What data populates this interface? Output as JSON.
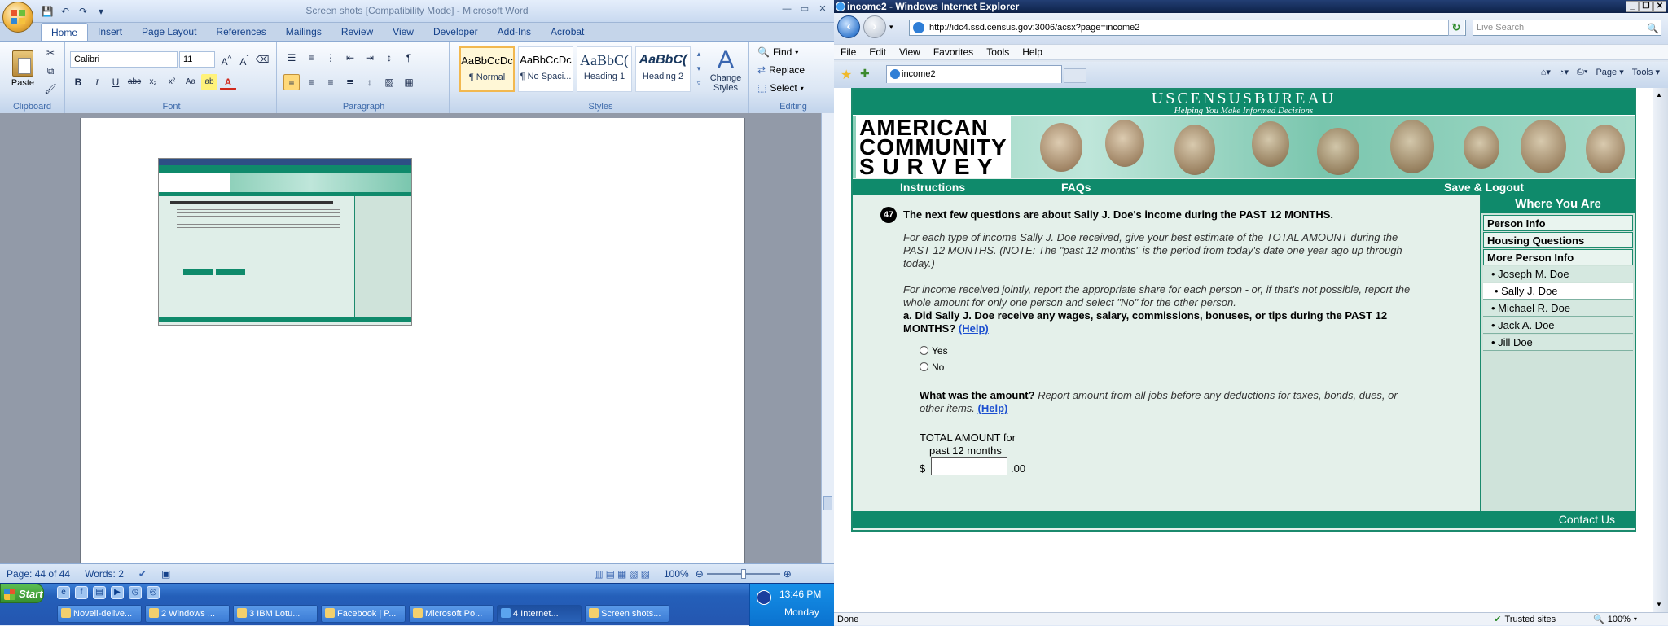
{
  "word": {
    "title": "Screen shots [Compatibility Mode] - Microsoft Word",
    "tabs": [
      "Home",
      "Insert",
      "Page Layout",
      "References",
      "Mailings",
      "Review",
      "View",
      "Developer",
      "Add-Ins",
      "Acrobat"
    ],
    "clipboard": {
      "paste": "Paste",
      "label": "Clipboard"
    },
    "font": {
      "name": "Calibri",
      "size": "11",
      "label": "Font"
    },
    "paragraph_label": "Paragraph",
    "styles": {
      "items": [
        {
          "preview": "AaBbCcDc",
          "name": "¶ Normal"
        },
        {
          "preview": "AaBbCcDc",
          "name": "¶ No Spaci..."
        },
        {
          "preview": "AaBbC(",
          "name": "Heading 1"
        },
        {
          "preview": "AaBbC(",
          "name": "Heading 2"
        }
      ],
      "change_styles": "Change Styles",
      "label": "Styles"
    },
    "editing": {
      "find": "Find",
      "replace": "Replace",
      "select": "Select",
      "label": "Editing"
    },
    "status": {
      "page": "Page: 44 of 44",
      "words": "Words: 2",
      "zoom": "100%"
    }
  },
  "taskbar": {
    "start": "Start",
    "buttons": [
      "Novell-delive...",
      "2 Windows ...",
      "3 IBM Lotu...",
      "Facebook | P...",
      "Microsoft Po...",
      "4 Internet...",
      "Screen shots..."
    ],
    "time": "13:46 PM",
    "day": "Monday"
  },
  "ie": {
    "title": "income2 - Windows Internet Explorer",
    "url": "http://idc4.ssd.census.gov:3006/acsx?page=income2",
    "search_placeholder": "Live Search",
    "menu": [
      "File",
      "Edit",
      "View",
      "Favorites",
      "Tools",
      "Help"
    ],
    "tab": "income2",
    "commands": [
      "Page",
      "Tools"
    ],
    "status_left": "Done",
    "status_zone": "Trusted sites",
    "status_zoom": "100%"
  },
  "census": {
    "header": "USCENSUSBUREAU",
    "tagline": "Helping You Make Informed Decisions",
    "logo": [
      "AMERICAN",
      "COMMUNITY",
      "S U R V E Y"
    ],
    "nav": {
      "instructions": "Instructions",
      "faqs": "FAQs",
      "save_logout": "Save & Logout"
    },
    "question_number": "47",
    "question_title": "The next few questions are about Sally J. Doe's income during the PAST 12 MONTHS.",
    "para1": "For each type of income Sally J. Doe received, give your best estimate of the TOTAL AMOUNT during the PAST 12 MONTHS. (NOTE: The \"past 12 months\" is the period from today's date one year ago up through today.)",
    "para2": "For income received jointly, report the appropriate share for each person - or, if that's not possible, report the whole amount for only one person and select \"No\" for the other person.",
    "part_a": "a. Did Sally J. Doe receive any wages, salary, commissions, bonuses, or tips during the PAST 12 MONTHS?",
    "help": "(Help)",
    "yes": "Yes",
    "no": "No",
    "amount_q": "What was the amount?",
    "amount_note": "Report amount from all jobs before any deductions for taxes, bonds, dues, or other items.",
    "total_label_1": "TOTAL AMOUNT for",
    "total_label_2": "past 12 months",
    "dollar": "$",
    "cents": ".00",
    "sidebar": {
      "title": "Where You Are",
      "items": [
        "Person Info",
        "Housing Questions",
        "More Person Info"
      ],
      "people": [
        "• Joseph M. Doe",
        "• Sally J. Doe",
        "• Michael R. Doe",
        "• Jack A. Doe",
        "• Jill Doe"
      ]
    },
    "contact": "Contact Us"
  }
}
